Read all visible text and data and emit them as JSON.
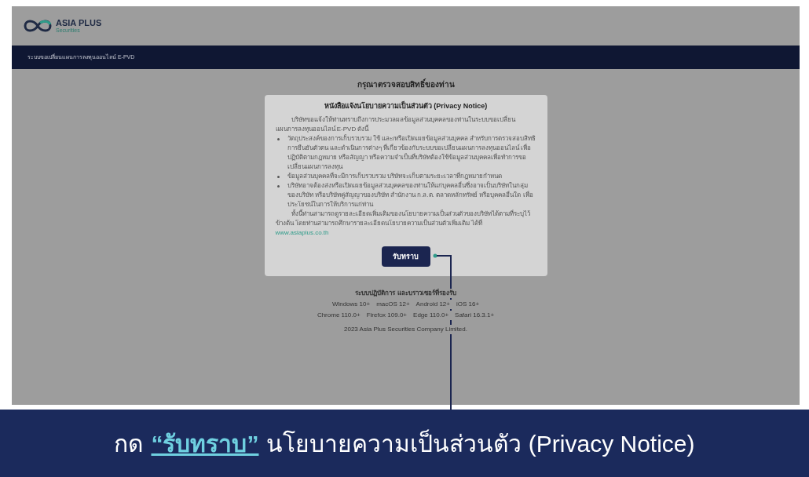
{
  "logo": {
    "text": "ASIA PLUS",
    "subtext": "Securities"
  },
  "header_bar": {
    "title": "ระบบขอเปลี่ยนแผนการลงทุนออนไลน์ E-PVD"
  },
  "page_title": "กรุณาตรวจสอบสิทธิ์ของท่าน",
  "modal": {
    "title": "หนังสือแจ้งนโยบายความเป็นส่วนตัว (Privacy Notice)",
    "paragraphs": [
      {
        "kind": "indent",
        "text": "บริษัทขอแจ้งให้ท่านทราบถึงการประมวลผลข้อมูลส่วนบุคคลของท่านในระบบขอเปลี่ยนแผนการลงทุนออนไลน์ E-PVD ดังนี้"
      },
      {
        "kind": "bullet",
        "text": "วัตถุประสงค์ของการเก็บรวบรวม ใช้ และ/หรือเปิดเผยข้อมูลส่วนบุคคล สำหรับการตรวจสอบสิทธิ การยืนยันตัวตน และดำเนินการต่างๆ ที่เกี่ยวข้องกับระบบขอเปลี่ยนแผนการลงทุนออนไลน์ เพื่อปฏิบัติตามกฎหมาย หรือสัญญา หรือความจำเป็นที่บริษัทต้องใช้ข้อมูลส่วนบุคคลเพื่อทำการขอเปลี่ยนแผนการลงทุน"
      },
      {
        "kind": "bullet",
        "text": "ข้อมูลส่วนบุคคลที่จะมีการเก็บรวบรวม บริษัทจะเก็บตามระยะเวลาที่กฎหมายกำหนด"
      },
      {
        "kind": "bullet",
        "text": "บริษัทอาจต้องส่งหรือเปิดเผยข้อมูลส่วนบุคคลของท่านให้แก่บุคคลอื่นซึ่งอาจเป็นบริษัทในกลุ่มของบริษัท หรือบริษัทคู่สัญญาของบริษัท สำนักงาน ก.ล.ต. ตลาดหลักทรัพย์ หรือบุคคลอื่นใด เพื่อประโยชน์ในการให้บริการแก่ท่าน"
      },
      {
        "kind": "indent",
        "text": "ทั้งนี้ท่านสามารถดูรายละเอียดเพิ่มเติมของนโยบายความเป็นส่วนตัวของบริษัทได้ตามที่ระบุไว้ข้างต้น โดยท่านสามารถศึกษารายละเอียดนโยบายความเป็นส่วนตัวเพิ่มเติม ได้ที่",
        "link": "www.asiaplus.co.th"
      }
    ],
    "button": "รับทราบ"
  },
  "footer": {
    "heading": "ระบบปฏิบัติการ และบราวเซอร์ที่รองรับ",
    "systems": [
      "Windows 10+",
      "macOS 12+",
      "Android 12+",
      "iOS 16+"
    ],
    "browsers": [
      "Chrome 110.0+",
      "Firefox 109.0+",
      "Edge 110.0+",
      "Safari 16.3.1+"
    ],
    "copyright": "2023 Asia Plus Securities Company Limited."
  },
  "caption": {
    "prefix": "กด",
    "highlight": "“รับทราบ”",
    "suffix": "นโยบายความเป็นส่วนตัว (Privacy Notice)"
  }
}
